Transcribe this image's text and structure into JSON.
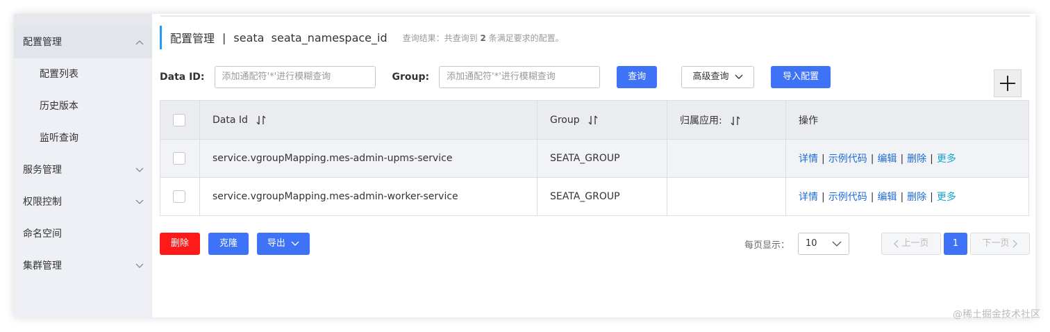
{
  "sidebar": {
    "items": [
      {
        "label": "配置管理",
        "caret": "chevron-up-icon"
      },
      {
        "label": "配置列表"
      },
      {
        "label": "历史版本"
      },
      {
        "label": "监听查询"
      },
      {
        "label": "服务管理",
        "caret": "chevron-down-icon"
      },
      {
        "label": "权限控制",
        "caret": "chevron-down-icon"
      },
      {
        "label": "命名空间"
      },
      {
        "label": "集群管理",
        "caret": "chevron-down-icon"
      }
    ]
  },
  "header": {
    "title": "配置管理",
    "separator": "|",
    "namespace": "seata  seata_namespace_id",
    "result_prefix": "查询结果：共查询到",
    "result_count": "2",
    "result_suffix": "条满足要求的配置。"
  },
  "filter": {
    "data_id_label": "Data ID:",
    "data_id_placeholder": "添加通配符'*'进行模糊查询",
    "group_label": "Group:",
    "group_placeholder": "添加通配符'*'进行模糊查询",
    "query_button": "查询",
    "advanced_button": "高级查询",
    "import_button": "导入配置"
  },
  "table": {
    "headers": [
      "Data Id",
      "Group",
      "归属应用:",
      "操作"
    ],
    "rows": [
      {
        "data_id": "service.vgroupMapping.mes-admin-upms-service",
        "group": "SEATA_GROUP",
        "app": ""
      },
      {
        "data_id": "service.vgroupMapping.mes-admin-worker-service",
        "group": "SEATA_GROUP",
        "app": ""
      }
    ],
    "ops": [
      "详情",
      "示例代码",
      "编辑",
      "删除",
      "更多"
    ],
    "op_separator": "|"
  },
  "footer": {
    "delete_button": "删除",
    "clone_button": "克隆",
    "export_button": "导出"
  },
  "pager": {
    "per_page_label": "每页显示：",
    "per_page_value": "10",
    "prev": "上一页",
    "current": "1",
    "next": "下一页"
  },
  "watermark": "@稀土掘金技术社区",
  "colors": {
    "primary": "#3e72f7",
    "danger": "#ff1a1a",
    "link": "#1d6cd6",
    "more_link": "#15a4d2",
    "accent": "#209bfa"
  }
}
